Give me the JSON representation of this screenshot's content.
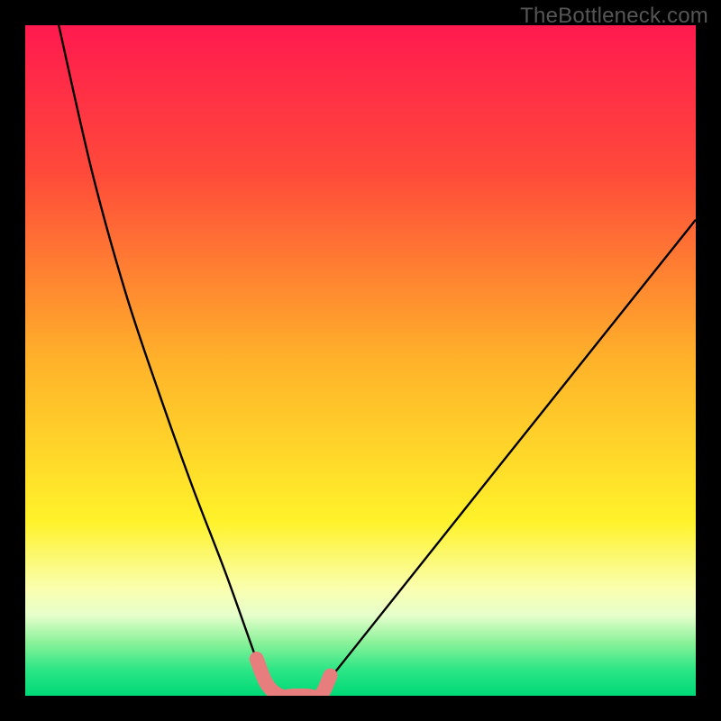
{
  "watermark": "TheBottleneck.com",
  "chart_data": {
    "type": "line",
    "title": "",
    "xlabel": "",
    "ylabel": "",
    "xlim": [
      0,
      100
    ],
    "ylim": [
      0,
      100
    ],
    "series": [
      {
        "name": "curve",
        "x": [
          5,
          10,
          15,
          20,
          25,
          30,
          35,
          36,
          38,
          40,
          42,
          44,
          45,
          100
        ],
        "y": [
          100,
          78,
          60,
          45,
          31,
          18,
          4,
          2,
          0,
          0,
          0,
          0,
          2,
          71
        ]
      },
      {
        "name": "highlight",
        "x": [
          34.5,
          36,
          38,
          40,
          42,
          44,
          45.5
        ],
        "y": [
          5.5,
          1.8,
          0,
          0,
          0,
          0,
          3
        ]
      }
    ],
    "gradient_stops": [
      {
        "pct": 0,
        "color": "#ff1a4f"
      },
      {
        "pct": 22,
        "color": "#ff4a3a"
      },
      {
        "pct": 50,
        "color": "#ffb22a"
      },
      {
        "pct": 74,
        "color": "#fff22a"
      },
      {
        "pct": 84,
        "color": "#faffaf"
      },
      {
        "pct": 88,
        "color": "#e6ffcc"
      },
      {
        "pct": 92,
        "color": "#8cf29a"
      },
      {
        "pct": 96,
        "color": "#2ee686"
      },
      {
        "pct": 100,
        "color": "#00d978"
      }
    ],
    "highlight_color": "#e77d7d",
    "curve_color": "#000000"
  }
}
